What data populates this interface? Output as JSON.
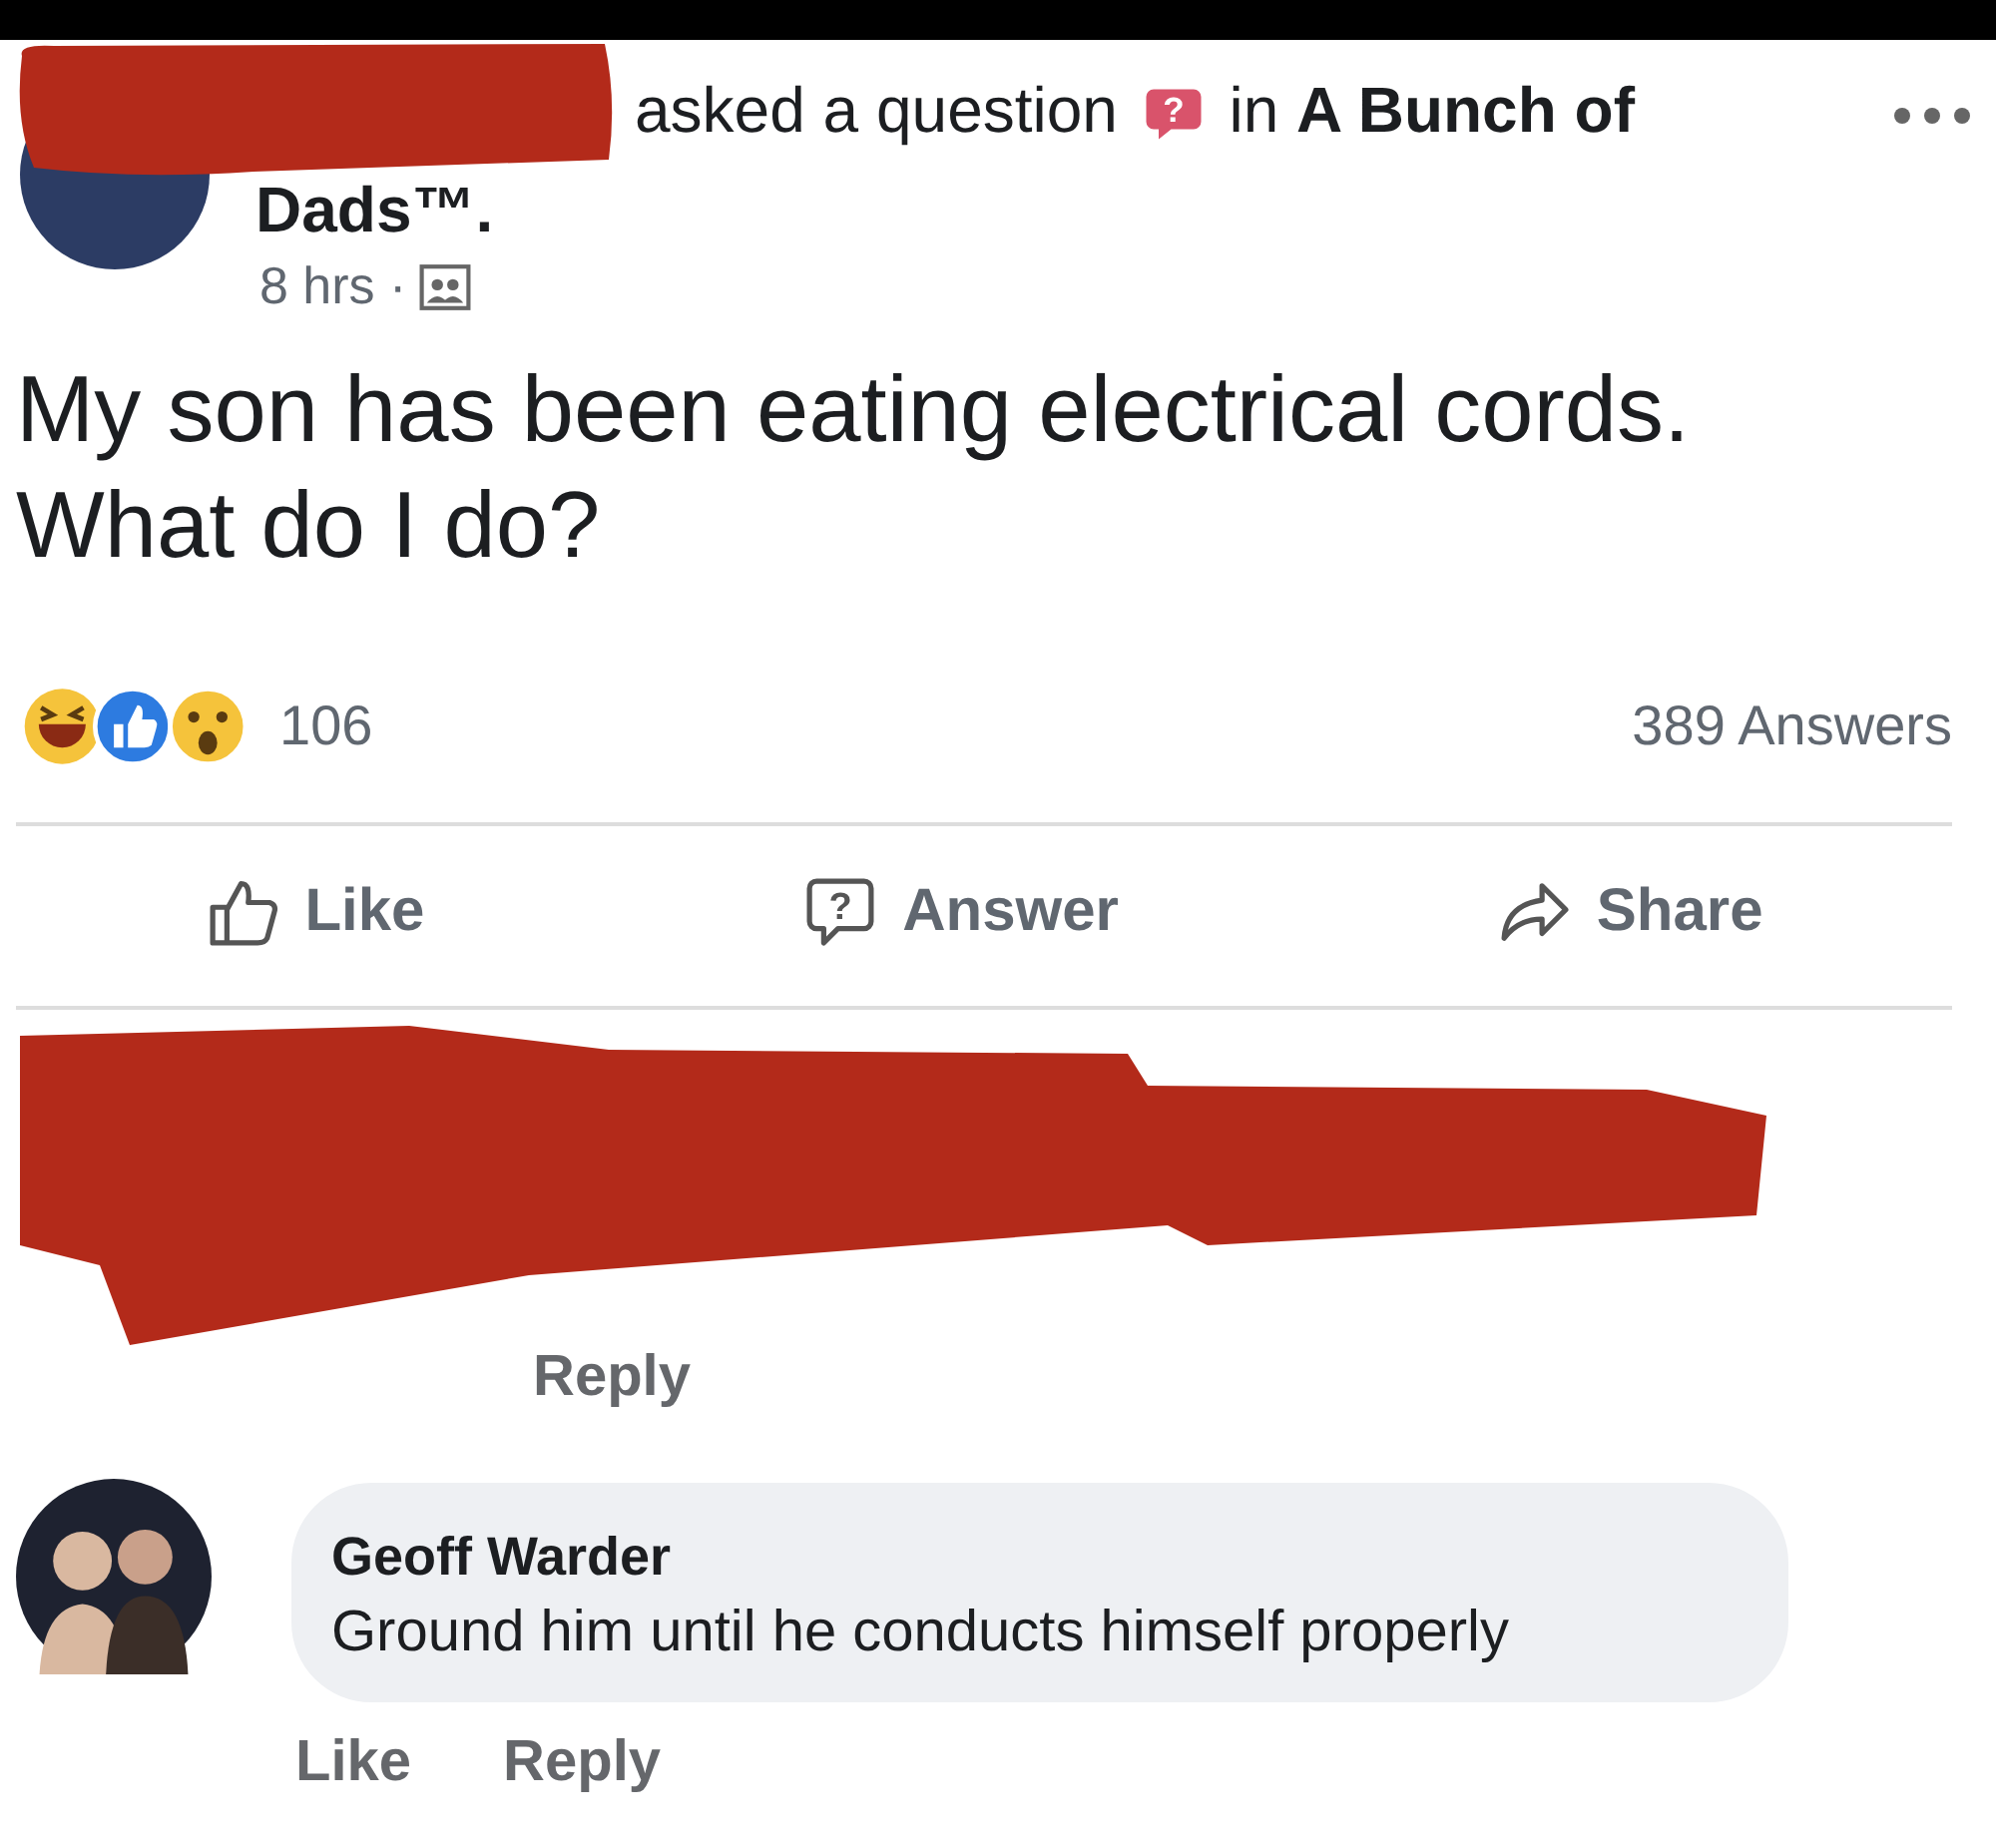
{
  "post": {
    "action": "asked a question",
    "badge_glyph": "?",
    "group": "in **A Bunch of**",
    "group_cont": "Dads™.",
    "time": "8 hrs ·",
    "question": "My son has been eating electrical cords. What do I do?",
    "reaction_count": "106",
    "answers_count": "389 Answers",
    "actions": [
      {
        "kind": "like",
        "label": "Like"
      },
      {
        "kind": "answer",
        "label": "Answer",
        "glyph": "?"
      },
      {
        "kind": "share",
        "label": "Share"
      }
    ]
  },
  "comments": [
    {
      "kind": "redacted",
      "actions": [
        "Reply"
      ]
    },
    {
      "kind": "comment",
      "author": "Geoff Warder",
      "text": "Ground him until he conducts himself properly",
      "actions": [
        "Like",
        "Reply"
      ]
    }
  ]
}
